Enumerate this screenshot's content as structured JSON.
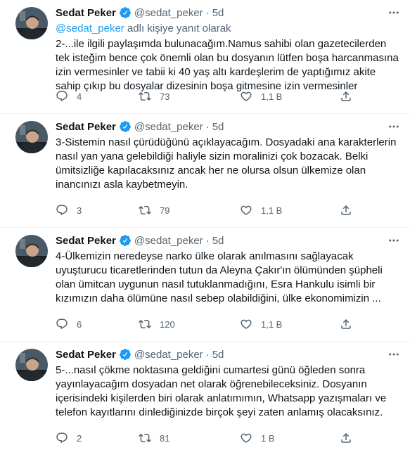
{
  "tweets": [
    {
      "name": "Sedat Peker",
      "handle": "@sedat_peker",
      "separator": "·",
      "time": "5d",
      "replying_link": "@sedat_peker",
      "replying_rest": " adlı kişiye yanıt olarak",
      "text": "2-...ile ilgili paylaşımda bulunacağım.Namus sahibi olan gazetecilerden tek isteğim bence çok önemli olan bu dosyanın lütfen boşa harcanmasına izin vermesinler ve tabii ki 40 yaş altı kardeşlerim de yaptığımız akite sahip çıkıp bu dosyalar dizesinin boşa gitmesine izin vermesinler",
      "replies": "4",
      "retweets": "73",
      "likes": "1,1 B"
    },
    {
      "name": "Sedat Peker",
      "handle": "@sedat_peker",
      "separator": "·",
      "time": "5d",
      "text": "3-Sistemin nasıl çürüdüğünü açıklayacağım. Dosyadaki ana karakterlerin nasıl yan yana gelebildiği haliyle sizin moralinizi çok bozacak. Belki ümitsizliğe kapılacaksınız ancak her ne olursa olsun ülkemize olan inancınızı asla kaybetmeyin.",
      "replies": "3",
      "retweets": "79",
      "likes": "1,1 B"
    },
    {
      "name": "Sedat Peker",
      "handle": "@sedat_peker",
      "separator": "·",
      "time": "5d",
      "text": "4-Ülkemizin neredeyse narko ülke olarak anılmasını sağlayacak uyuşturucu ticaretlerinden tutun da Aleyna Çakır'ın ölümünden şüpheli olan ümitcan uygunun nasıl tutuklanmadığını, Esra Hankulu isimli bir kızımızın daha ölümüne nasıl sebep olabildiğini, ülke ekonomimizin ...",
      "replies": "6",
      "retweets": "120",
      "likes": "1,1 B"
    },
    {
      "name": "Sedat Peker",
      "handle": "@sedat_peker",
      "separator": "·",
      "time": "5d",
      "text": "5-...nasıl çökme noktasına geldiğini cumartesi günü öğleden sonra yayınlayacağım dosyadan net olarak öğrenebileceksiniz. Dosyanın içerisindeki kişilerden biri olarak anlatımımın, Whatsapp yazışmaları ve telefon kayıtlarını dinlediğinizde birçok şeyi zaten anlamış olacaksınız.",
      "replies": "2",
      "retweets": "81",
      "likes": "1 B"
    }
  ],
  "colors": {
    "text": "#0f1419",
    "secondary": "#536471",
    "link": "#1d9bf0",
    "verified": "#1d9bf0",
    "divider": "#eff3f4"
  },
  "icons": [
    "avatar",
    "verified-badge-icon",
    "more-icon",
    "reply-icon",
    "retweet-icon",
    "like-icon",
    "share-icon"
  ]
}
